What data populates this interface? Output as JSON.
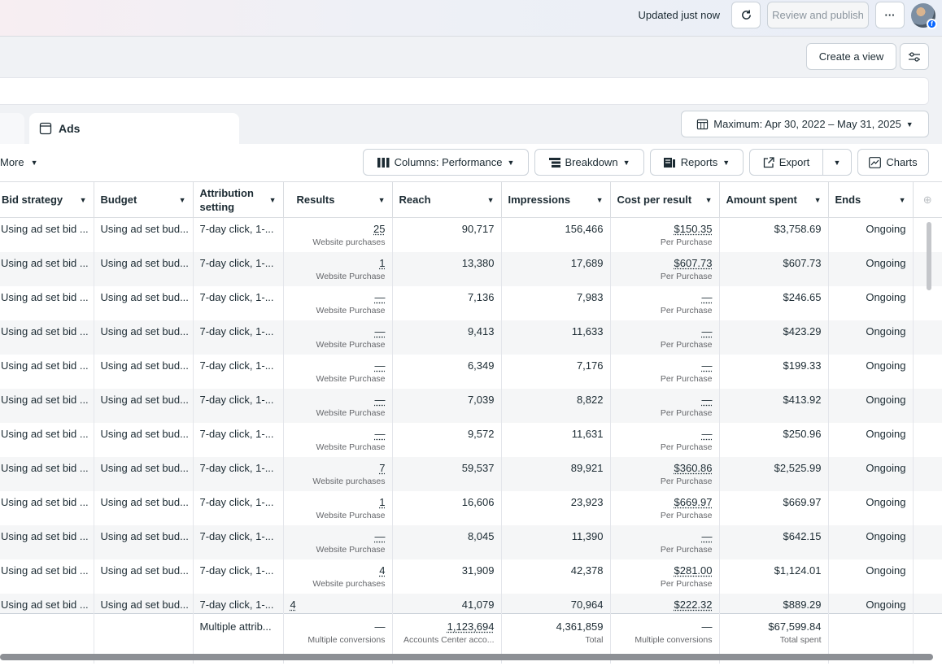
{
  "header": {
    "updated": "Updated just now",
    "refresh_icon": "refresh-icon",
    "review_publish": "Review and publish",
    "more_label": "···"
  },
  "view": {
    "create_view": "Create a view",
    "settings_icon": "sliders-icon"
  },
  "tabs": {
    "ads_label": "Ads",
    "date_range": "Maximum: Apr 30, 2022 – May 31, 2025"
  },
  "toolbar": {
    "more": "More",
    "columns": "Columns: Performance",
    "breakdown": "Breakdown",
    "reports": "Reports",
    "export": "Export",
    "charts": "Charts"
  },
  "columns": [
    "Bid strategy",
    "Budget",
    "Attribution setting",
    "Results",
    "Reach",
    "Impressions",
    "Cost per result",
    "Amount spent",
    "Ends"
  ],
  "rows": [
    {
      "bid": "Using ad set bid ...",
      "budget": "Using ad set bud...",
      "attr": "7-day click, 1-...",
      "results": "25",
      "results_sub": "Website purchases",
      "reach": "90,717",
      "impr": "156,466",
      "cpr": "$150.35",
      "cpr_sub": "Per Purchase",
      "spent": "$3,758.69",
      "ends": "Ongoing"
    },
    {
      "bid": "Using ad set bid ...",
      "budget": "Using ad set bud...",
      "attr": "7-day click, 1-...",
      "results": "1",
      "results_sub": "Website Purchase",
      "reach": "13,380",
      "impr": "17,689",
      "cpr": "$607.73",
      "cpr_sub": "Per Purchase",
      "spent": "$607.73",
      "ends": "Ongoing"
    },
    {
      "bid": "Using ad set bid ...",
      "budget": "Using ad set bud...",
      "attr": "7-day click, 1-...",
      "results": "—",
      "results_sub": "Website Purchase",
      "reach": "7,136",
      "impr": "7,983",
      "cpr": "—",
      "cpr_sub": "Per Purchase",
      "spent": "$246.65",
      "ends": "Ongoing"
    },
    {
      "bid": "Using ad set bid ...",
      "budget": "Using ad set bud...",
      "attr": "7-day click, 1-...",
      "results": "—",
      "results_sub": "Website Purchase",
      "reach": "9,413",
      "impr": "11,633",
      "cpr": "—",
      "cpr_sub": "Per Purchase",
      "spent": "$423.29",
      "ends": "Ongoing"
    },
    {
      "bid": "Using ad set bid ...",
      "budget": "Using ad set bud...",
      "attr": "7-day click, 1-...",
      "results": "—",
      "results_sub": "Website Purchase",
      "reach": "6,349",
      "impr": "7,176",
      "cpr": "—",
      "cpr_sub": "Per Purchase",
      "spent": "$199.33",
      "ends": "Ongoing"
    },
    {
      "bid": "Using ad set bid ...",
      "budget": "Using ad set bud...",
      "attr": "7-day click, 1-...",
      "results": "—",
      "results_sub": "Website Purchase",
      "reach": "7,039",
      "impr": "8,822",
      "cpr": "—",
      "cpr_sub": "Per Purchase",
      "spent": "$413.92",
      "ends": "Ongoing"
    },
    {
      "bid": "Using ad set bid ...",
      "budget": "Using ad set bud...",
      "attr": "7-day click, 1-...",
      "results": "—",
      "results_sub": "Website Purchase",
      "reach": "9,572",
      "impr": "11,631",
      "cpr": "—",
      "cpr_sub": "Per Purchase",
      "spent": "$250.96",
      "ends": "Ongoing"
    },
    {
      "bid": "Using ad set bid ...",
      "budget": "Using ad set bud...",
      "attr": "7-day click, 1-...",
      "results": "7",
      "results_sub": "Website purchases",
      "reach": "59,537",
      "impr": "89,921",
      "cpr": "$360.86",
      "cpr_sub": "Per Purchase",
      "spent": "$2,525.99",
      "ends": "Ongoing"
    },
    {
      "bid": "Using ad set bid ...",
      "budget": "Using ad set bud...",
      "attr": "7-day click, 1-...",
      "results": "1",
      "results_sub": "Website Purchase",
      "reach": "16,606",
      "impr": "23,923",
      "cpr": "$669.97",
      "cpr_sub": "Per Purchase",
      "spent": "$669.97",
      "ends": "Ongoing"
    },
    {
      "bid": "Using ad set bid ...",
      "budget": "Using ad set bud...",
      "attr": "7-day click, 1-...",
      "results": "—",
      "results_sub": "Website Purchase",
      "reach": "8,045",
      "impr": "11,390",
      "cpr": "—",
      "cpr_sub": "Per Purchase",
      "spent": "$642.15",
      "ends": "Ongoing"
    },
    {
      "bid": "Using ad set bid ...",
      "budget": "Using ad set bud...",
      "attr": "7-day click, 1-...",
      "results": "4",
      "results_sub": "Website purchases",
      "reach": "31,909",
      "impr": "42,378",
      "cpr": "$281.00",
      "cpr_sub": "Per Purchase",
      "spent": "$1,124.01",
      "ends": "Ongoing"
    },
    {
      "bid": "Using ad set bid ...",
      "budget": "Using ad set bud...",
      "attr": "7-day click, 1-...",
      "results": "4",
      "results_sub": "",
      "reach": "41,079",
      "impr": "70,964",
      "cpr": "$222.32",
      "cpr_sub": "",
      "spent": "$889.29",
      "ends": "Ongoing"
    }
  ],
  "totals": {
    "attr": "Multiple attrib...",
    "results": "—",
    "results_sub": "Multiple conversions",
    "reach": "1,123,694",
    "reach_sub": "Accounts Center acco...",
    "impr": "4,361,859",
    "impr_sub": "Total",
    "cpr": "—",
    "cpr_sub": "Multiple conversions",
    "spent": "$67,599.84",
    "spent_sub": "Total spent"
  }
}
